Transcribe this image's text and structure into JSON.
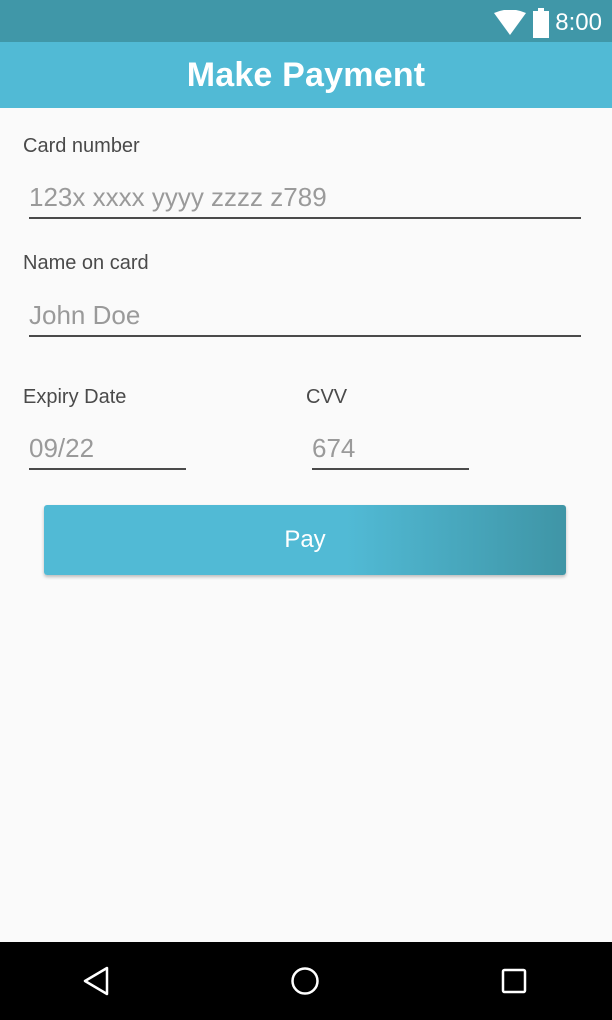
{
  "status_bar": {
    "time": "8:00",
    "icons": [
      "wifi-icon",
      "battery-icon"
    ]
  },
  "app_bar": {
    "title": "Make Payment"
  },
  "form": {
    "card_number": {
      "label": "Card number",
      "placeholder": "123x xxxx yyyy zzzz z789",
      "value": ""
    },
    "name_on_card": {
      "label": "Name on card",
      "placeholder": "John Doe",
      "value": ""
    },
    "expiry_date": {
      "label": "Expiry Date",
      "placeholder": "09/22",
      "value": ""
    },
    "cvv": {
      "label": "CVV",
      "placeholder": "674",
      "value": ""
    },
    "pay_button_label": "Pay"
  },
  "nav_bar": {
    "buttons": [
      "back-icon",
      "home-icon",
      "recents-icon"
    ]
  },
  "colors": {
    "status_bar": "#4097a8",
    "app_bar": "#51bad5",
    "button_start": "#51bad5",
    "button_end": "#3f95a6",
    "background": "#fafafa",
    "nav_bar": "#000000"
  }
}
